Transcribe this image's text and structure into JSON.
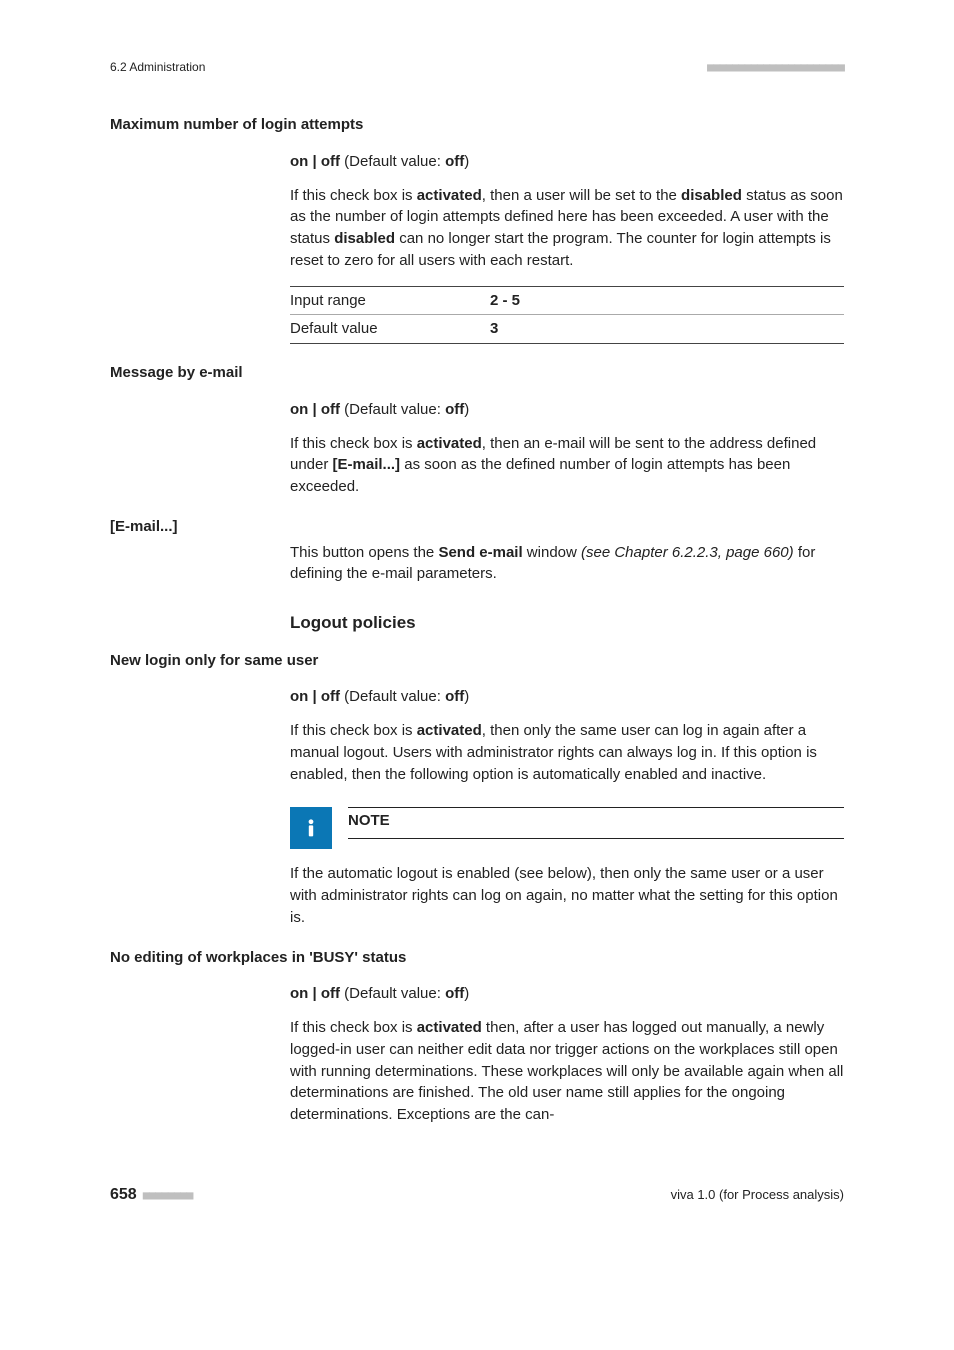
{
  "runningHead": {
    "left": "6.2 Administration",
    "dots": "■■■■■■■■■■■■■■■■■■■■■■"
  },
  "entries": {
    "maxLogin": {
      "term": "Maximum number of login attempts",
      "onoff_prefix": "on | off",
      "onoff_paren_open": " (Default value: ",
      "onoff_default": "off",
      "onoff_paren_close": ")",
      "para_a_pre": "If this check box is ",
      "para_a_b1": "activated",
      "para_a_mid1": ", then a user will be set to the ",
      "para_a_b2": "disabled",
      "para_a_mid2": " status as soon as the number of login attempts defined here has been exceeded. A user with the status ",
      "para_a_b3": "disabled",
      "para_a_post": " can no longer start the program. The counter for login attempts is reset to zero for all users with each restart.",
      "table": {
        "r1_label": "Input range",
        "r1_val": "2 - 5",
        "r2_label": "Default value",
        "r2_val": "3"
      }
    },
    "msgEmail": {
      "term": "Message by e-mail",
      "onoff_prefix": "on | off",
      "onoff_paren_open": " (Default value: ",
      "onoff_default": "off",
      "onoff_paren_close": ")",
      "para_pre": "If this check box is ",
      "para_b1": "activated",
      "para_mid": ", then an e-mail will be sent to the address defined under ",
      "para_b2": "[E-mail...]",
      "para_post": " as soon as the defined number of login attempts has been exceeded."
    },
    "emailBtn": {
      "term": "[E-mail...]",
      "para_pre": "This button opens the ",
      "para_b1": "Send e-mail",
      "para_mid": " window ",
      "para_it": "(see Chapter 6.2.2.3, page 660)",
      "para_post": " for defining the e-mail parameters."
    },
    "logoutSection": "Logout policies",
    "newLogin": {
      "term": "New login only for same user",
      "onoff_prefix": "on | off",
      "onoff_paren_open": " (Default value: ",
      "onoff_default": "off",
      "onoff_paren_close": ")",
      "para_pre": "If this check box is ",
      "para_b1": "activated",
      "para_post": ", then only the same user can log in again after a manual logout. Users with administrator rights can always log in. If this option is enabled, then the following option is automatically enabled and inactive."
    },
    "note": {
      "title": "NOTE",
      "body": "If the automatic logout is enabled (see below), then only the same user or a user with administrator rights can log on again, no matter what the setting for this option is."
    },
    "noEdit": {
      "term": "No editing of workplaces in 'BUSY' status",
      "onoff_prefix": "on | off",
      "onoff_paren_open": " (Default value: ",
      "onoff_default": "off",
      "onoff_paren_close": ")",
      "para_pre": "If this check box is ",
      "para_b1": "activated",
      "para_post": " then, after a user has logged out manually, a newly logged-in user can neither edit data nor trigger actions on the workplaces still open with running determinations. These workplaces will only be available again when all determinations are finished. The old user name still applies for the ongoing determinations. Exceptions are the can-"
    }
  },
  "footer": {
    "page": "658",
    "dots": "■■■■■■■■",
    "right": "viva 1.0 (for Process analysis)"
  }
}
